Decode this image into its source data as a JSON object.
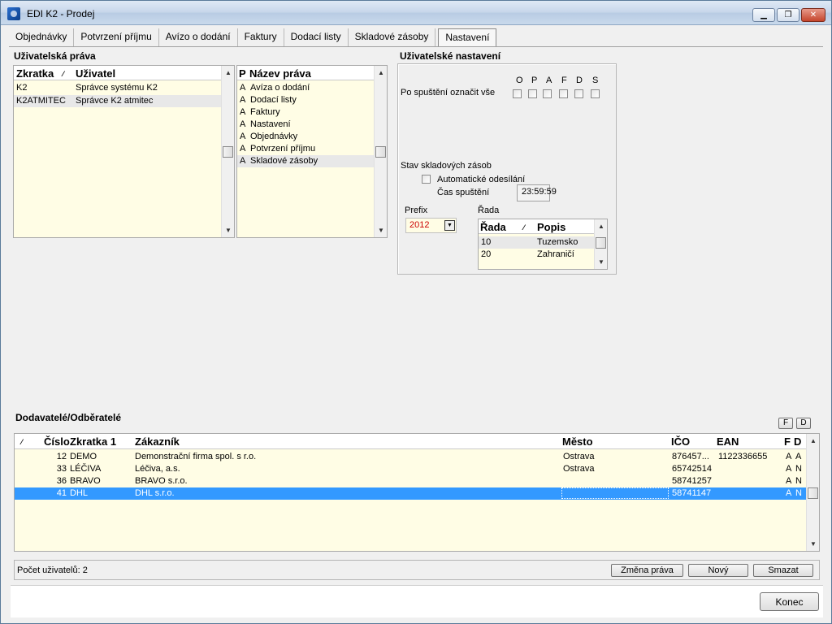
{
  "window": {
    "title": "EDI K2 - Prodej"
  },
  "window_buttons": {
    "minimize": "▁",
    "restore": "❐",
    "close": "✕"
  },
  "tabs": [
    {
      "label": "Objednávky"
    },
    {
      "label": "Potvrzení příjmu"
    },
    {
      "label": "Avízo o dodání"
    },
    {
      "label": "Faktury"
    },
    {
      "label": "Dodací listy"
    },
    {
      "label": "Skladové zásoby"
    },
    {
      "label": "Nastavení",
      "active": true
    }
  ],
  "user_rights": {
    "title": "Uživatelská práva",
    "users_grid": {
      "headers": {
        "abbr": "Zkratka",
        "sort_mark": "⁄",
        "user": "Uživatel"
      },
      "rows": [
        {
          "abbr": "K2",
          "user": "Správce systému K2"
        },
        {
          "abbr": "K2ATMITEC",
          "user": "Správce K2 atmitec"
        }
      ]
    },
    "rights_grid": {
      "headers": {
        "p": "P",
        "name": "Název práva"
      },
      "rows": [
        {
          "p": "A",
          "name": "Avíza o dodání"
        },
        {
          "p": "A",
          "name": "Dodací listy"
        },
        {
          "p": "A",
          "name": "Faktury"
        },
        {
          "p": "A",
          "name": "Nastavení"
        },
        {
          "p": "A",
          "name": "Objednávky"
        },
        {
          "p": "A",
          "name": "Potvrzení příjmu"
        },
        {
          "p": "A",
          "name": "Skladové zásoby"
        }
      ]
    }
  },
  "user_settings": {
    "title": "Uživatelské nastavení",
    "mark_all_label": "Po spuštění označit vše",
    "flags": [
      "O",
      "P",
      "A",
      "F",
      "D",
      "S"
    ],
    "stock_section_label": "Stav skladových zásob",
    "auto_send_label": "Automatické odesílání",
    "run_time_label": "Čas spuštění",
    "run_time_value": "23:59:59",
    "prefix_label": "Prefix",
    "prefix_value": "2012",
    "series_label": "Řada",
    "series_grid": {
      "headers": {
        "series": "Řada",
        "sort_mark": "⁄",
        "desc": "Popis"
      },
      "rows": [
        {
          "series": "10",
          "desc": "Tuzemsko"
        },
        {
          "series": "20",
          "desc": "Zahraničí"
        }
      ]
    }
  },
  "partners": {
    "title": "Dodavatelé/Odběratelé",
    "buttons": {
      "f": "F",
      "d": "D"
    },
    "headers": {
      "sort_mark": "⁄",
      "number": "Číslo",
      "abbr": "Zkratka 1",
      "customer": "Zákazník",
      "city": "Město",
      "ico": "IČO",
      "ean": "EAN",
      "f": "F",
      "d": "D"
    },
    "rows": [
      {
        "number": "12",
        "abbr": "DEMO",
        "customer": "Demonstrační firma spol. s r.o.",
        "city": "Ostrava",
        "ico": "876457...",
        "ean": "1122336655",
        "f": "A",
        "d": "A"
      },
      {
        "number": "33",
        "abbr": "LÉČIVA",
        "customer": "Léčiva, a.s.",
        "city": "Ostrava",
        "ico": "65742514",
        "ean": "",
        "f": "A",
        "d": "N"
      },
      {
        "number": "36",
        "abbr": "BRAVO",
        "customer": "BRAVO s.r.o.",
        "city": "",
        "ico": "58741257",
        "ean": "",
        "f": "A",
        "d": "N"
      },
      {
        "number": "41",
        "abbr": "DHL",
        "customer": "DHL s.r.o.",
        "city": "",
        "ico": "58741147",
        "ean": "",
        "f": "A",
        "d": "N",
        "selected": true
      }
    ]
  },
  "status": {
    "user_count": "Počet uživatelů: 2",
    "change_rights_button": "Změna práva",
    "new_button": "Nový",
    "delete_button": "Smazat"
  },
  "footer": {
    "close_button": "Konec"
  },
  "colors": {
    "grid_bg": "#fffde5",
    "selected_row": "#3399ff",
    "prefix_text": "#cc0000"
  }
}
